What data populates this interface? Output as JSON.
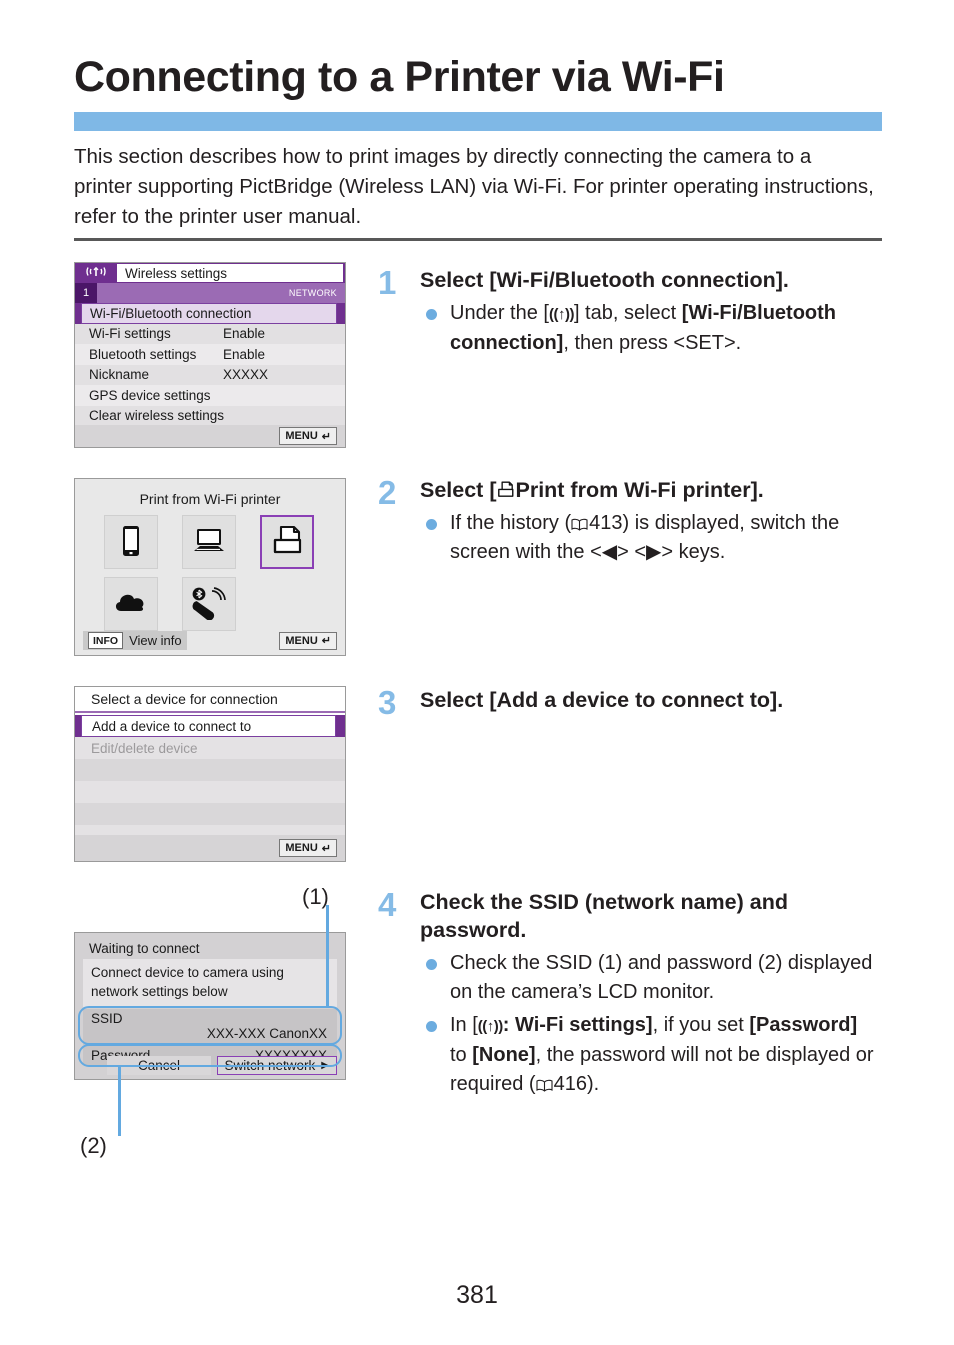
{
  "page": {
    "title": "Connecting to a Printer via Wi-Fi",
    "intro": "This section describes how to print images by directly connecting the camera to a printer supporting PictBridge (Wireless LAN) via Wi-Fi. For printer operating instructions, refer to the printer user manual.",
    "number": "381",
    "accent_color": "#7fb8e6",
    "step_number_color": "#85bbe6",
    "bullet_color": "#6cacdf",
    "callout_color": "#63a9e0",
    "menu_purple": "#6f2f8f"
  },
  "screens": {
    "wireless_settings": {
      "header_icon": "wifi-antenna-icon",
      "header_title": "Wireless settings",
      "tab_number": "1",
      "tab_group": "NETWORK",
      "rows": [
        {
          "label": "Wi-Fi/Bluetooth connection",
          "value": "",
          "selected": true
        },
        {
          "label": "Wi-Fi settings",
          "value": "Enable",
          "selected": false
        },
        {
          "label": "Bluetooth settings",
          "value": "Enable",
          "selected": false
        },
        {
          "label": "Nickname",
          "value": "XXXXX",
          "selected": false
        },
        {
          "label": "GPS device settings",
          "value": "",
          "selected": false
        },
        {
          "label": "Clear wireless settings",
          "value": "",
          "selected": false
        }
      ],
      "menu_button": "MENU",
      "menu_return_icon": "return-arrow-icon"
    },
    "device_select": {
      "title": "Print from Wi-Fi printer",
      "tiles": [
        {
          "icon": "smartphone-icon",
          "selected": false
        },
        {
          "icon": "computer-icon",
          "selected": false
        },
        {
          "icon": "printer-icon",
          "selected": true
        },
        {
          "icon": "cloud-icon",
          "selected": false
        },
        {
          "icon": "bluetooth-remote-icon",
          "selected": false
        }
      ],
      "info_button": "INFO",
      "info_label": "View info",
      "menu_button": "MENU",
      "menu_return_icon": "return-arrow-icon"
    },
    "connection_list": {
      "title": "Select a device for connection",
      "rows": [
        {
          "label": "Add a device to connect to",
          "selected": true,
          "disabled": false
        },
        {
          "label": "Edit/delete device",
          "selected": false,
          "disabled": true
        }
      ],
      "menu_button": "MENU",
      "menu_return_icon": "return-arrow-icon"
    },
    "waiting_to_connect": {
      "title": "Waiting to connect",
      "message": "Connect device to camera using network settings below",
      "ssid_label": "SSID",
      "ssid_value": "XXX-XXX  CanonXX",
      "password_label": "Password",
      "password_value": "XXXXXXXX",
      "cancel_button": "Cancel",
      "switch_network_button": "Switch network",
      "switch_network_arrow_icon": "chevron-right-icon",
      "callout_ssid": "(1)",
      "callout_password": "(2)"
    }
  },
  "steps": [
    {
      "number": "1",
      "heading": "Select [Wi-Fi/Bluetooth connection].",
      "bullets": [
        {
          "parts": [
            {
              "t": "Under the [",
              "b": false
            },
            {
              "t": "((↑))",
              "b": true,
              "glyph": "wifi"
            },
            {
              "t": "] tab, select ",
              "b": false
            },
            {
              "t": "[Wi-Fi/Bluetooth connection]",
              "b": true
            },
            {
              "t": ", then press <SET>.",
              "b": false
            }
          ]
        }
      ]
    },
    {
      "number": "2",
      "heading": "Select [⎙Print from Wi-Fi printer].",
      "bullets": [
        {
          "parts": [
            {
              "t": "If the history (",
              "b": false
            },
            {
              "t": "📖",
              "b": false,
              "glyph": "book"
            },
            {
              "t": "413) is displayed, switch the screen with the <◀> <▶> keys.",
              "b": false
            }
          ]
        }
      ]
    },
    {
      "number": "3",
      "heading": "Select [Add a device to connect to].",
      "bullets": []
    },
    {
      "number": "4",
      "heading": "Check the SSID (network name) and password.",
      "bullets": [
        {
          "parts": [
            {
              "t": "Check the SSID (1) and password (2) displayed on the camera’s LCD monitor.",
              "b": false
            }
          ]
        },
        {
          "parts": [
            {
              "t": "In [",
              "b": false
            },
            {
              "t": "((↑))",
              "b": true,
              "glyph": "wifi"
            },
            {
              "t": ": Wi-Fi settings]",
              "b": true
            },
            {
              "t": ", if you set ",
              "b": false
            },
            {
              "t": "[Password]",
              "b": true
            },
            {
              "t": " to ",
              "b": false
            },
            {
              "t": "[None]",
              "b": true
            },
            {
              "t": ", the password will not be displayed or required (",
              "b": false
            },
            {
              "t": "📖",
              "b": false,
              "glyph": "book"
            },
            {
              "t": "416).",
              "b": false
            }
          ]
        }
      ]
    }
  ]
}
